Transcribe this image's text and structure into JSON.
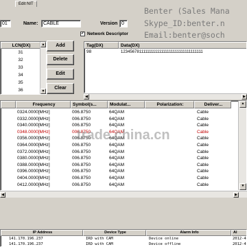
{
  "tab": {
    "label": "Edit NIT"
  },
  "form": {
    "id_value": "01",
    "name_label": "Name:",
    "name_value": "CABLE",
    "version_label": "Version",
    "version_value": "0",
    "network_descriptor_label": "Network Descriptor",
    "network_descriptor_checked": true
  },
  "lcn_list": {
    "header": "LCN(DX)",
    "items": [
      "31",
      "32",
      "33",
      "34",
      "35",
      "36"
    ]
  },
  "buttons": {
    "add": "Add",
    "delete": "Delete",
    "edit": "Edit",
    "clear": "Clear"
  },
  "descriptor_table": {
    "columns": [
      "Tag(DX)",
      "Data(DX)"
    ],
    "rows": [
      {
        "tag": "98",
        "data": "1234567811111111111111111111111111111111"
      }
    ]
  },
  "transport_table": {
    "columns": [
      "Frequency",
      "Symbol(s...",
      "Modulat...",
      "Polarization:",
      "Deliver..."
    ],
    "rows": [
      {
        "freq": "0324.0000[MHz]",
        "symbol": "006.8750",
        "mod": "64QAM",
        "deliver": "Cable",
        "selected": false
      },
      {
        "freq": "0332.0000[MHz]",
        "symbol": "006.8750",
        "mod": "64QAM",
        "deliver": "Cable",
        "selected": false
      },
      {
        "freq": "0340.0000[MHz]",
        "symbol": "006.8750",
        "mod": "64QAM",
        "deliver": "Cable",
        "selected": false
      },
      {
        "freq": "0348.0000[MHz]",
        "symbol": "006.8750",
        "mod": "64QAM",
        "deliver": "Cable",
        "selected": true
      },
      {
        "freq": "0356.0000[MHz]",
        "symbol": "006.8750",
        "mod": "64QAM",
        "deliver": "Cable",
        "selected": false
      },
      {
        "freq": "0364.0000[MHz]",
        "symbol": "006.8750",
        "mod": "64QAM",
        "deliver": "Cable",
        "selected": false
      },
      {
        "freq": "0372.0000[MHz]",
        "symbol": "006.8750",
        "mod": "64QAM",
        "deliver": "Cable",
        "selected": false
      },
      {
        "freq": "0380.0000[MHz]",
        "symbol": "006.8750",
        "mod": "64QAM",
        "deliver": "Cable",
        "selected": false
      },
      {
        "freq": "0388.0000[MHz]",
        "symbol": "006.8750",
        "mod": "64QAM",
        "deliver": "Cable",
        "selected": false
      },
      {
        "freq": "0396.0000[MHz]",
        "symbol": "006.8750",
        "mod": "64QAM",
        "deliver": "Cable",
        "selected": false
      },
      {
        "freq": "0404.0000[MHz]",
        "symbol": "006.8750",
        "mod": "64QAM",
        "deliver": "Cable",
        "selected": false
      },
      {
        "freq": "0412.0000[MHz]",
        "symbol": "006.8750",
        "mod": "64QAM",
        "deliver": "Cable",
        "selected": false
      }
    ]
  },
  "device_table": {
    "columns": [
      "IP Address",
      "Device Type",
      "Alarm Info",
      "Al"
    ],
    "rows": [
      {
        "ip": "141.170.196.237",
        "type": "IRD with CAM",
        "alarm": "Device online",
        "time": "2012-4"
      },
      {
        "ip": "141.170.196.237",
        "type": "IRD with CAM",
        "alarm": "Device offline",
        "time": "2012-4"
      }
    ]
  },
  "watermark": {
    "line1": "Benter (Sales Mana",
    "line2": "Skype_ID:benter.n",
    "line3": "Email:benter@soch",
    "site": "trade.china.cn"
  },
  "colors": {
    "selected_row_text": "#c00000",
    "window_bg": "#d4d0c8"
  }
}
